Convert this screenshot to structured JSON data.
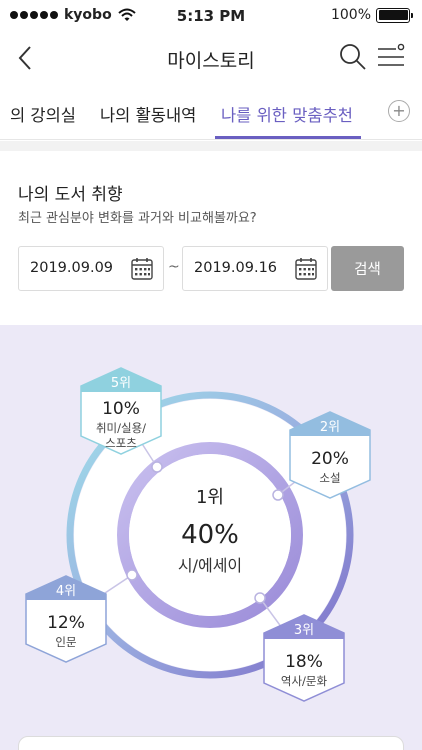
{
  "status_bar": {
    "carrier": "kyobo",
    "time": "5:13 PM",
    "battery": "100%"
  },
  "nav": {
    "title": "마이스토리"
  },
  "tabs": [
    {
      "label": "의 강의실",
      "active": false
    },
    {
      "label": "나의 활동내역",
      "active": false
    },
    {
      "label": "나를 위한 맞춤추천",
      "active": true
    }
  ],
  "tab_add_label": "+",
  "section": {
    "title": "나의 도서 취향",
    "subtitle": "최근 관심분야 변화를 과거와 비교해볼까요?",
    "start_date": "2019.09.09",
    "separator": "~",
    "end_date": "2019.09.16",
    "search_label": "검색"
  },
  "chart_data": {
    "type": "pie",
    "categories": [
      "시/에세이",
      "소설",
      "역사/문화",
      "인문",
      "취미/실용/스포츠"
    ],
    "values": [
      40,
      20,
      18,
      12,
      10
    ],
    "ranks": [
      "1위",
      "2위",
      "3위",
      "4위",
      "5위"
    ],
    "value_labels": [
      "40%",
      "20%",
      "18%",
      "12%",
      "10%"
    ],
    "category_lines": [
      [
        "시/에세이"
      ],
      [
        "소설"
      ],
      [
        "역사/문화"
      ],
      [
        "인문"
      ],
      [
        "취미/실용/",
        "스포츠"
      ]
    ],
    "colors": [
      "#a99ddb",
      "#93bde0",
      "#8f8ed6",
      "#8ea4d8",
      "#8fd1df"
    ]
  }
}
